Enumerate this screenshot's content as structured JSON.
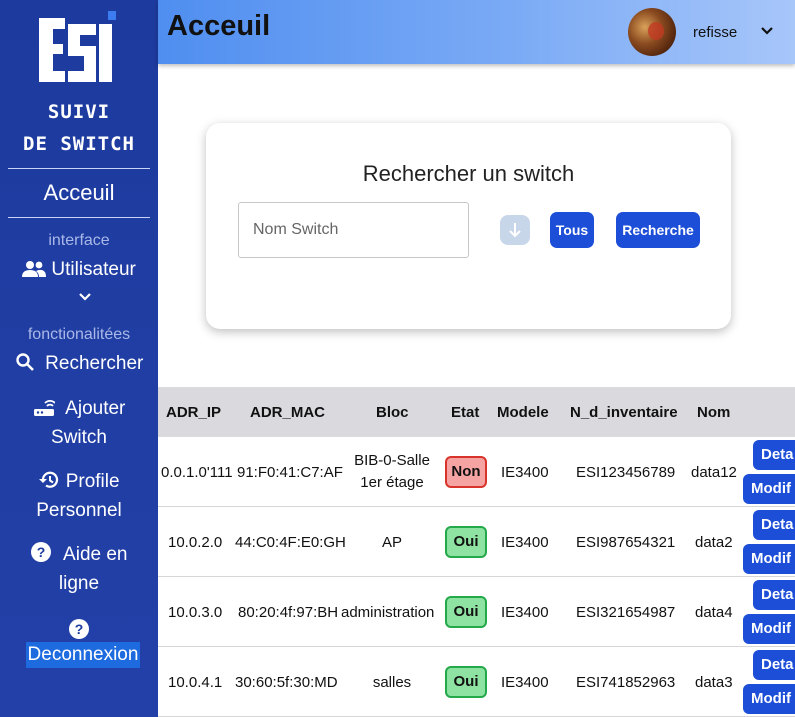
{
  "sidebar": {
    "logo_alt": "esi",
    "brand_line1": "SUIVI",
    "brand_line2": "DE SWITCH",
    "home": "Acceuil",
    "section_interface": "interface",
    "users": "Utilisateur",
    "section_features": "fonctionalitées",
    "search": "Rechercher",
    "add_line1": "Ajouter",
    "add_line2": "Switch",
    "profile_line1": "Profile",
    "profile_line2": "Personnel",
    "help_line1": "Aide en",
    "help_line2": "ligne",
    "logout": "Deconnexion"
  },
  "header": {
    "title": "Acceuil",
    "username": "refisse"
  },
  "search": {
    "title": "Rechercher un switch",
    "placeholder": "Nom Switch",
    "btn_all": "Tous",
    "btn_search": "Recherche"
  },
  "table": {
    "columns": [
      "ADR_IP",
      "ADR_MAC",
      "Bloc",
      "Etat",
      "Modele",
      "N_d_inventaire",
      "Nom"
    ],
    "rows": [
      {
        "ip": "0.0.1.0'111",
        "mac": "91:F0:41:C7:AF",
        "bloc1": "BIB-0-Salle",
        "bloc2": "1er étage",
        "etat": "Non",
        "modele": "IE3400",
        "inv": "ESI123456789",
        "nom": "data12",
        "details": "Deta",
        "modify": "Modif"
      },
      {
        "ip": "10.0.2.0",
        "mac": "44:C0:4F:E0:GH",
        "bloc1": "AP",
        "bloc2": "",
        "etat": "Oui",
        "modele": "IE3400",
        "inv": "ESI987654321",
        "nom": "data2",
        "details": "Deta",
        "modify": "Modif"
      },
      {
        "ip": "10.0.3.0",
        "mac": "80:20:4f:97:BH",
        "bloc1": "administration",
        "bloc2": "",
        "etat": "Oui",
        "modele": "IE3400",
        "inv": "ESI321654987",
        "nom": "data4",
        "details": "Deta",
        "modify": "Modif"
      },
      {
        "ip": "10.0.4.1",
        "mac": "30:60:5f:30:MD",
        "bloc1": "salles",
        "bloc2": "",
        "etat": "Oui",
        "modele": "IE3400",
        "inv": "ESI741852963",
        "nom": "data3",
        "details": "Deta",
        "modify": "Modif"
      }
    ]
  },
  "colors": {
    "sidebar": "#1d3b9e",
    "accent": "#1d4ed8",
    "status_no": "#f5a3a3",
    "status_yes": "#8fe3a2"
  }
}
